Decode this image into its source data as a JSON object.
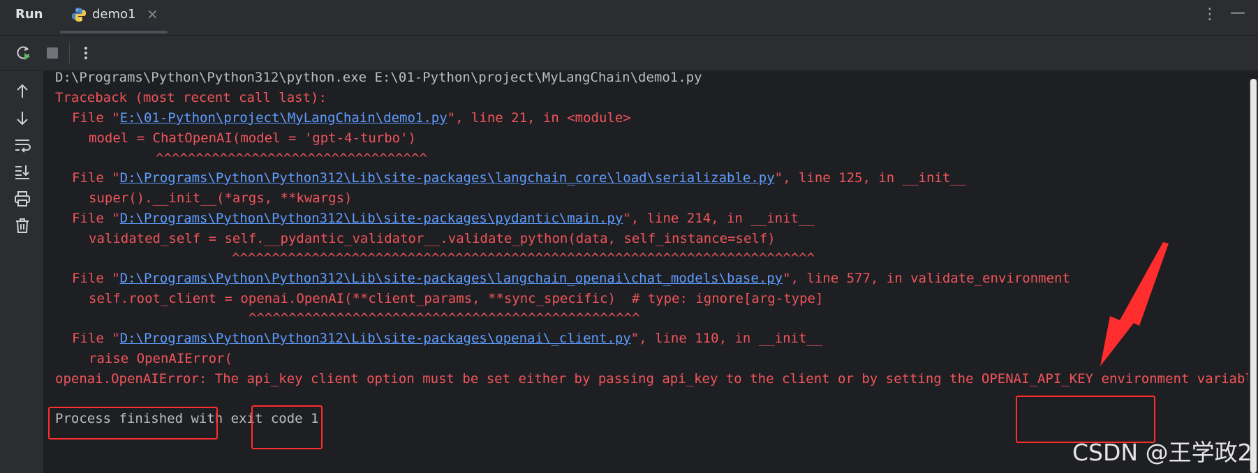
{
  "header": {
    "run_label": "Run",
    "tab_label": "demo1",
    "tab_close": "×",
    "more": "⋮",
    "minimize": "—"
  },
  "console": {
    "lines": [
      "D:\\Programs\\Python\\Python312\\python.exe E:\\01-Python\\project\\MyLangChain\\demo1.py",
      "Traceback (most recent call last):",
      "model = ChatOpenAI(model = 'gpt-4-turbo')",
      "^^^^^^^^^^^^^^^^^^^^^^^^^^^^^^^^^^",
      "super().__init__(*args, **kwargs)",
      "validated_self = self.__pydantic_validator__.validate_python(data, self_instance=self)",
      "^^^^^^^^^^^^^^^^^^^^^^^^^^^^^^^^^^^^^^^^^^^^^^^^^^^^^^^^^^^^^^^^^^^^^^^^^",
      "self.root_client = openai.OpenAI(**client_params, **sync_specific)  # type: ignore[arg-type]",
      "^^^^^^^^^^^^^^^^^^^^^^^^^^^^^^^^^^^^^^^^^^^^^^^^^",
      "raise OpenAIError(",
      "openai.OpenAIError: The api_key client option must be set either by passing api_key to the client or by setting the OPENAI_API_KEY environment variable",
      "Process finished with exit code 1"
    ],
    "file_lines": [
      {
        "prefix": "File \"",
        "link": "E:\\01-Python\\project\\MyLangChain\\demo1.py",
        "suffix": "\", line 21, in <module>"
      },
      {
        "prefix": "File \"",
        "link": "D:\\Programs\\Python\\Python312\\Lib\\site-packages\\langchain_core\\load\\serializable.py",
        "suffix": "\", line 125, in __init__"
      },
      {
        "prefix": "File \"",
        "link": "D:\\Programs\\Python\\Python312\\Lib\\site-packages\\pydantic\\main.py",
        "suffix": "\", line 214, in __init__"
      },
      {
        "prefix": "File \"",
        "link": "D:\\Programs\\Python\\Python312\\Lib\\site-packages\\langchain_openai\\chat_models\\base.py",
        "suffix": "\", line 577, in validate_environment"
      },
      {
        "prefix": "File \"",
        "link": "D:\\Programs\\Python\\Python312\\Lib\\site-packages\\openai\\_client.py",
        "suffix": "\", line 110, in __init__"
      }
    ]
  },
  "watermark": "CSDN @王学政2",
  "colors": {
    "error": "#f0555b",
    "link": "#5e9dff",
    "highlight": "#ff2d2d",
    "background": "#1e1f22",
    "panel": "#2b2d30"
  }
}
